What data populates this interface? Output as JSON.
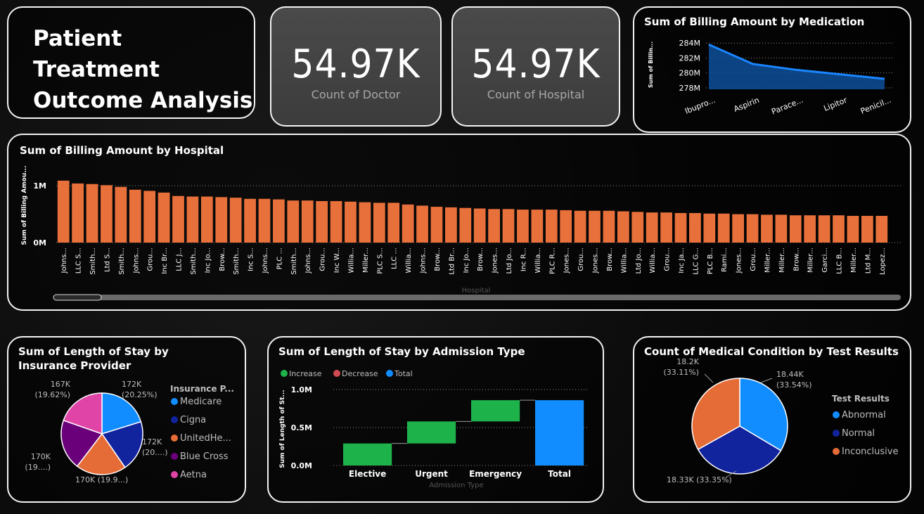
{
  "header": {
    "title_line1": "Patient Treatment",
    "title_line2": "Outcome Analysis"
  },
  "kpis": [
    {
      "value": "54.97K",
      "label": "Count of Doctor"
    },
    {
      "value": "54.97K",
      "label": "Count of Hospital"
    }
  ],
  "colors": {
    "bar": "#e8703a",
    "area": "#1a86ff",
    "increase": "#1db34a",
    "decrease": "#d04a52",
    "total": "#118dff",
    "pie1": "#118dff",
    "pie2": "#12239e",
    "pie3": "#e66c37",
    "pie4": "#6b007b",
    "pie5": "#e044a7"
  },
  "chart_data": [
    {
      "id": "medication",
      "type": "area",
      "title": "Sum of Billing Amount by Medication",
      "ylabel": "Sum of Billin...",
      "categories": [
        "Ibupro...",
        "Aspirin",
        "Parace...",
        "Lipitor",
        "Penicil..."
      ],
      "values": [
        283.8,
        281.2,
        280.4,
        279.8,
        279.2
      ],
      "ylim": [
        277.8,
        284.4
      ],
      "yticks": [
        278,
        280,
        282,
        284
      ],
      "ytick_labels": [
        "278M",
        "280M",
        "282M",
        "284M"
      ]
    },
    {
      "id": "hospital",
      "type": "bar",
      "title": "Sum of Billing Amount by Hospital",
      "xlabel": "Hospital",
      "ylabel": "Sum of Billing Amou...",
      "ylim": [
        0,
        1.2
      ],
      "ytick_labels": [
        "0M",
        "1M"
      ],
      "categories": [
        "Johns...",
        "LLC S...",
        "Smith...",
        "Ltd S...",
        "Smith...",
        "Johns...",
        "Grou...",
        "Inc Br...",
        "LLC J...",
        "Smith...",
        "Inc Jo...",
        "Brow...",
        "Smith...",
        "Inc S...",
        "Johns...",
        "PLC ...",
        "Smith...",
        "Johns...",
        "Grou...",
        "Inc W...",
        "Willia...",
        "Miller...",
        "PLC S...",
        "LLC ...",
        "Willia...",
        "Johns...",
        "Brow...",
        "Ltd Br...",
        "Inc Jo...",
        "Brow...",
        "Jones...",
        "Ltd Jo...",
        "Inc R...",
        "Willia...",
        "PLC R...",
        "Jones...",
        "Grou...",
        "Jones...",
        "Brow...",
        "Willia...",
        "Ltd Jo...",
        "Willia...",
        "Grou...",
        "Inc Ja...",
        "LLC G...",
        "PLC B...",
        "Rami...",
        "Jones...",
        "Grou...",
        "Miller...",
        "Miller...",
        "Brow...",
        "Miller...",
        "Garci...",
        "LLC B...",
        "Miller...",
        "Ltd M...",
        "Lopez..."
      ],
      "values": [
        1.09,
        1.04,
        1.03,
        1.01,
        0.98,
        0.93,
        0.91,
        0.88,
        0.82,
        0.81,
        0.81,
        0.8,
        0.79,
        0.77,
        0.77,
        0.76,
        0.74,
        0.74,
        0.73,
        0.73,
        0.72,
        0.71,
        0.7,
        0.7,
        0.67,
        0.65,
        0.63,
        0.62,
        0.61,
        0.6,
        0.59,
        0.59,
        0.58,
        0.58,
        0.58,
        0.57,
        0.56,
        0.56,
        0.56,
        0.55,
        0.54,
        0.53,
        0.53,
        0.52,
        0.52,
        0.51,
        0.51,
        0.5,
        0.5,
        0.49,
        0.49,
        0.48,
        0.48,
        0.48,
        0.48,
        0.47,
        0.47,
        0.47
      ]
    },
    {
      "id": "insurance",
      "type": "pie",
      "title": "Sum of Length of Stay by Insurance Provider",
      "legend_title": "Insurance P...",
      "series": [
        {
          "name": "Medicare",
          "value": 172,
          "label1": "172K",
          "label2": "(20.25%)"
        },
        {
          "name": "Cigna",
          "value": 172,
          "label1": "172K",
          "label2": "(20....)"
        },
        {
          "name": "UnitedHe...",
          "value": 170,
          "label1": "170K (19.9...)",
          "label2": ""
        },
        {
          "name": "Blue Cross",
          "value": 170,
          "label1": "170K",
          "label2": "(19....)"
        },
        {
          "name": "Aetna",
          "value": 167,
          "label1": "167K",
          "label2": "(19.62%)"
        }
      ]
    },
    {
      "id": "admission",
      "type": "waterfall",
      "title": "Sum of Length of Stay by Admission Type",
      "xlabel": "Admission Type",
      "ylabel": "Sum of Length of St...",
      "legend": [
        "Increase",
        "Decrease",
        "Total"
      ],
      "categories": [
        "Elective",
        "Urgent",
        "Emergency",
        "Total"
      ],
      "values": [
        0.29,
        0.29,
        0.28,
        0.86
      ],
      "ylim": [
        0,
        1.0
      ],
      "ytick_labels": [
        "0.0M",
        "0.5M",
        "1.0M"
      ]
    },
    {
      "id": "testresults",
      "type": "pie",
      "title": "Count of Medical Condition by Test Results",
      "legend_title": "Test Results",
      "series": [
        {
          "name": "Abnormal",
          "value": 18.44,
          "label1": "18.44K",
          "label2": "(33.54%)"
        },
        {
          "name": "Normal",
          "value": 18.33,
          "label1": "18.33K (33.35%)",
          "label2": ""
        },
        {
          "name": "Inconclusive",
          "value": 18.2,
          "label1": "18.2K",
          "label2": "(33.11%)"
        }
      ]
    }
  ]
}
